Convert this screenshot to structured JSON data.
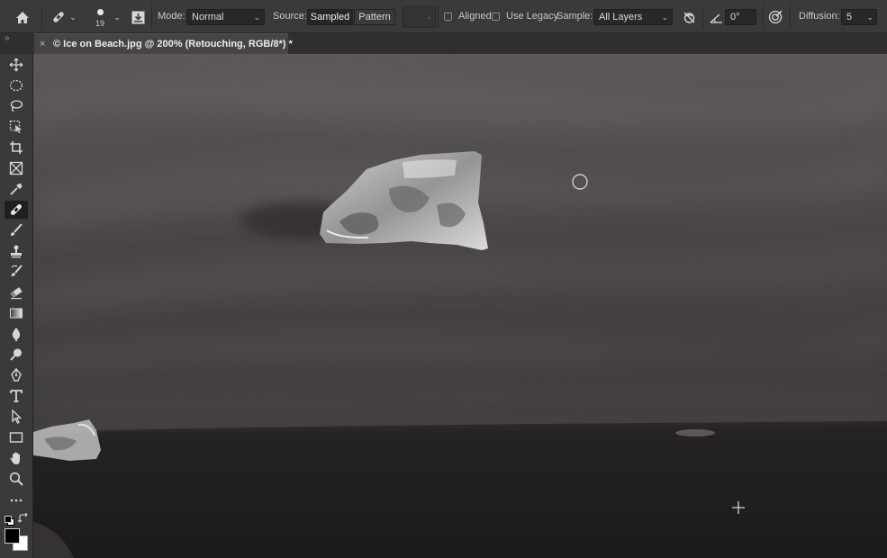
{
  "options_bar": {
    "brush_size": "19",
    "mode_label": "Mode:",
    "mode_value": "Normal",
    "source_label": "Source:",
    "source_sampled": "Sampled",
    "source_pattern": "Pattern",
    "aligned_label": "Aligned",
    "use_legacy_label": "Use Legacy",
    "sample_label": "Sample:",
    "sample_value": "All Layers",
    "angle_value": "0°",
    "diffusion_label": "Diffusion:",
    "diffusion_value": "5"
  },
  "document_tab": {
    "close_glyph": "×",
    "title": "© Ice on Beach.jpg @ 200% (Retouching, RGB/8*) *"
  },
  "panel_collapse_glyph": "»",
  "toolbar": {
    "active_tool": "healing-brush-tool",
    "tools": [
      "move-tool-icon",
      "marquee-tool-icon",
      "lasso-tool-icon",
      "object-select-tool-icon",
      "crop-tool-icon",
      "frame-tool-icon",
      "eyedropper-tool-icon",
      "healing-brush-tool-icon",
      "brush-tool-icon",
      "clone-stamp-tool-icon",
      "history-brush-tool-icon",
      "eraser-tool-icon",
      "gradient-tool-icon",
      "blur-tool-icon",
      "dodge-tool-icon",
      "pen-tool-icon",
      "type-tool-icon",
      "path-select-tool-icon",
      "rectangle-tool-icon",
      "hand-tool-icon",
      "zoom-tool-icon",
      "more-tools-icon"
    ],
    "foreground_color": "#000000",
    "background_color": "#ffffff"
  },
  "canvas": {
    "subject": "ice on black sand beach, grayscale",
    "sand_color": "#4a4747",
    "wet_sand_color": "#1e1c1c"
  }
}
